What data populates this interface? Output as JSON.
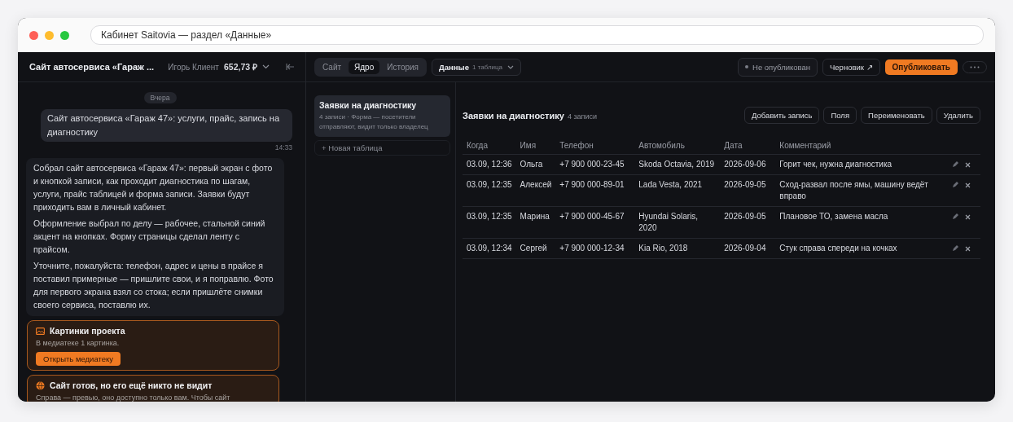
{
  "window": {
    "title": "Кабинет Saitovia — раздел «Данные»"
  },
  "chat": {
    "title": "Сайт автосервиса «Гараж ...",
    "user": "Игорь Клиент",
    "balance": "652,73 ₽",
    "day": "Вчера",
    "messages": [
      {
        "kind": "user",
        "text": "Сайт автосервиса «Гараж 47»: услуги, прайс, запись на диагностику",
        "time": "14:33"
      },
      {
        "kind": "bot",
        "paragraphs": [
          "Собрал сайт автосервиса «Гараж 47»: первый экран с фото и кнопкой записи, как проходит диагностика по шагам, услуги, прайс таблицей и форма записи. Заявки будут приходить вам в личный кабинет.",
          "Оформление выбрал по делу — рабочее, стальной синий акцент на кнопках. Форму страницы сделал ленту с прайсом.",
          "Уточните, пожалуйста: телефон, адрес и цены в прайсе я поставил примерные — пришлите свои, и я поправлю. Фото для первого экрана взял со стока; если пришлёте снимки своего сервиса, поставлю их."
        ]
      },
      {
        "kind": "media",
        "title": "Картинки проекта",
        "text": "В медиатеке 1 картинка.",
        "action": "Открыть медиатеку"
      },
      {
        "kind": "publish",
        "title": "Сайт готов, но его ещё никто не видит",
        "text": "Справа — превью, оно доступно только вам. Чтобы сайт"
      }
    ]
  },
  "tabs": [
    {
      "label": "Сайт",
      "selected": false
    },
    {
      "label": "Ядро",
      "selected": true
    },
    {
      "label": "История",
      "selected": false
    }
  ],
  "data_menu": {
    "label": "Данные",
    "count": "1 таблица"
  },
  "status": "Не опубликован",
  "draft_button": "Черновик ↗",
  "publish_button": "Опубликовать",
  "tables": [
    {
      "title": "Заявки на диагностику",
      "meta": "4 записи · Форма — посетители отправляют, видит только владелец",
      "selected": true
    }
  ],
  "new_table": "+ Новая таблица",
  "table": {
    "title": "Заявки на диагностику",
    "count": "4 записи",
    "actions": [
      "Добавить запись",
      "Поля",
      "Переименовать",
      "Удалить"
    ],
    "columns": [
      "Когда",
      "Имя",
      "Телефон",
      "Автомобиль",
      "Дата",
      "Комментарий"
    ],
    "rows": [
      [
        "03.09, 12:36",
        "Ольга",
        "+7 900 000-23-45",
        "Skoda Octavia, 2019",
        "2026-09-06",
        "Горит чек, нужна диагностика"
      ],
      [
        "03.09, 12:35",
        "Алексей",
        "+7 900 000-89-01",
        "Lada Vesta, 2021",
        "2026-09-05",
        "Сход-развал после ямы, машину ведёт вправо"
      ],
      [
        "03.09, 12:35",
        "Марина",
        "+7 900 000-45-67",
        "Hyundai Solaris, 2020",
        "2026-09-05",
        "Плановое ТО, замена масла"
      ],
      [
        "03.09, 12:34",
        "Сергей",
        "+7 900 000-12-34",
        "Kia Rio, 2018",
        "2026-09-04",
        "Стук справа спереди на кочках"
      ]
    ]
  }
}
